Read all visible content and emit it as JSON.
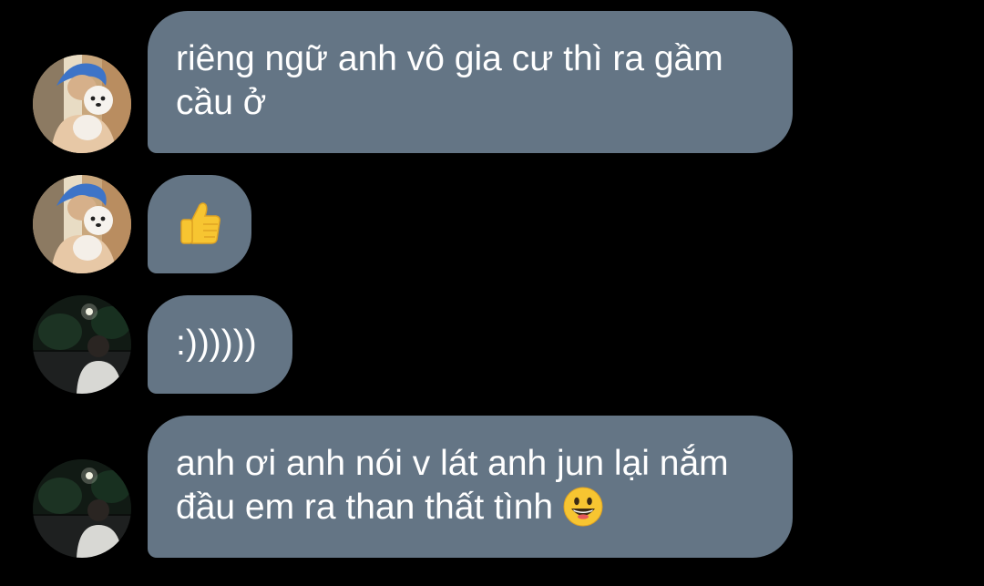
{
  "conversation": {
    "messages": [
      {
        "avatar": "blue-hair-dog-avatar",
        "lines": [
          "riêng ngữ anh vô gia cư thì ra gầm",
          "cầu ở"
        ]
      },
      {
        "avatar": "blue-hair-dog-avatar",
        "emoji": "thumbs-up-icon"
      },
      {
        "avatar": "night-street-avatar",
        "lines": [
          ":))))))"
        ]
      },
      {
        "avatar": "night-street-avatar",
        "lines": [
          "anh ơi anh nói v lát anh jun lại nắm",
          "đầu em ra than thất tình"
        ],
        "trailing_emoji": "grinning-face-icon"
      }
    ]
  },
  "colors": {
    "background": "#000000",
    "bubble": "#647585",
    "text": "#ffffff"
  }
}
